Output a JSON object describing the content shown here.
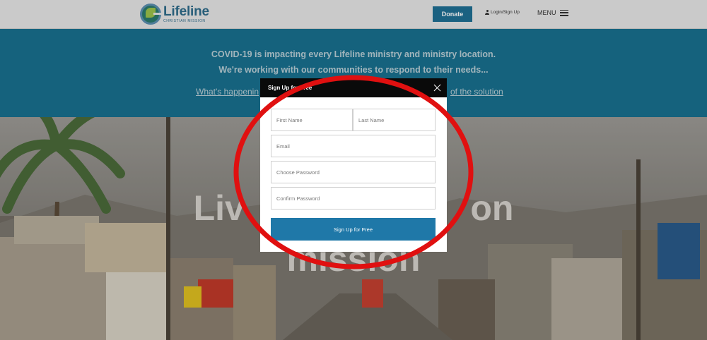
{
  "header": {
    "logo_name": "Lifeline",
    "logo_sub": "CHRISTIAN MISSION",
    "donate_label": "Donate",
    "login_label": "Login/Sign Up",
    "menu_label": "MENU"
  },
  "banner": {
    "line1": "COVID-19 is impacting every Lifeline ministry and ministry location.",
    "line2": "We're working with our communities to respond to their needs...",
    "link_left": "What's happenin",
    "link_right": "of the solution"
  },
  "hero": {
    "title_line1": "Liv                       on",
    "title_line2": "mission"
  },
  "modal": {
    "title": "Sign Up for Free",
    "first_name_placeholder": "First Name",
    "last_name_placeholder": "Last Name",
    "email_placeholder": "Email",
    "password_placeholder": "Choose Password",
    "confirm_placeholder": "Confirm Password",
    "submit_label": "Sign Up for Free"
  },
  "colors": {
    "brand_blue": "#1e6f93",
    "banner_teal": "#19708f",
    "button_blue": "#1f78a8",
    "annotation_red": "#e01010"
  }
}
